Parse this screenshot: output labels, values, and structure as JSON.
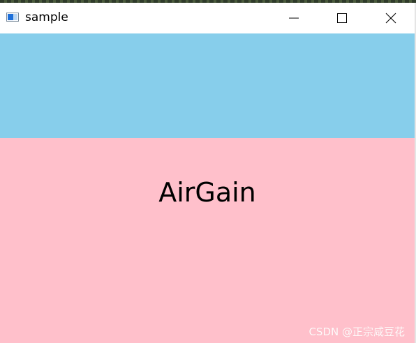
{
  "window": {
    "title": "sample",
    "icon": "application-window-icon"
  },
  "titlebar_buttons": {
    "minimize": "minimize-icon",
    "maximize": "maximize-icon",
    "close": "close-icon"
  },
  "colors": {
    "top_panel": "#87CEEB",
    "bottom_panel": "#FFC0CB",
    "text": "#000000"
  },
  "content": {
    "main_label": "AirGain"
  },
  "watermark": {
    "text": "CSDN @正宗咸豆花"
  }
}
